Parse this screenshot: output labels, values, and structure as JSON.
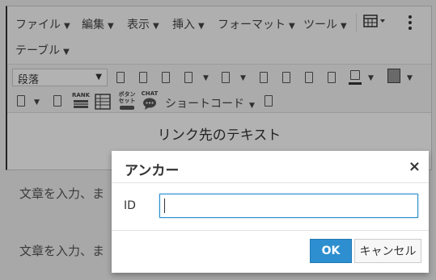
{
  "menubar": {
    "items": [
      {
        "label": "ファイル"
      },
      {
        "label": "編集"
      },
      {
        "label": "表示"
      },
      {
        "label": "挿入"
      },
      {
        "label": "フォーマット"
      },
      {
        "label": "ツール"
      },
      {
        "label": "テーブル"
      }
    ]
  },
  "toolbar": {
    "format_value": "段落",
    "shortcode_label": "ショートコード",
    "rank_label": "RANK",
    "button_label_1": "ボタン",
    "button_label_2": "セット",
    "chat_label": "CHAT"
  },
  "editor": {
    "content_text": "リンク先のテキスト"
  },
  "page": {
    "text_1": "文章を入力、ま",
    "text_2": "文章を入力、ま"
  },
  "dialog": {
    "title": "アンカー",
    "close": "×",
    "id_label": "ID",
    "id_value": "",
    "ok_label": "OK",
    "cancel_label": "キャンセル"
  },
  "colors": {
    "primary": "#2d8fd0",
    "overlay": "rgba(0,0,0,0.30)"
  }
}
